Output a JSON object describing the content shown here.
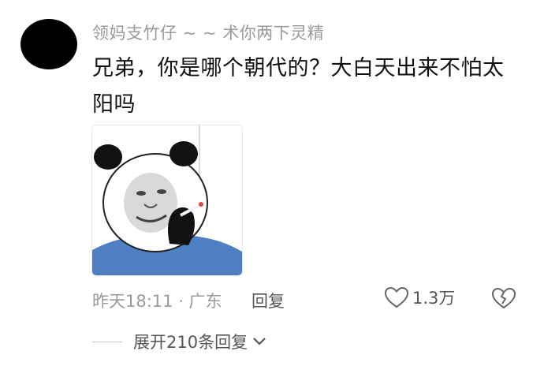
{
  "comment": {
    "username": "领妈支竹仔 ~ ~ 术你两下灵精",
    "text": "兄弟，你是哪个朝代的？大白天出来不怕太阳吗",
    "time": "昨天18:11 · 广东",
    "reply_label": "回复",
    "like_count": "1.3万"
  },
  "expand": {
    "label": "展开210条回复"
  },
  "icons": {
    "like": "heart-outline-icon",
    "dislike": "broken-heart-icon",
    "expand": "chevron-down-icon"
  },
  "colors": {
    "text_primary": "#111111",
    "text_secondary": "#9a9a9a",
    "panda_shirt": "#4f80c5"
  }
}
